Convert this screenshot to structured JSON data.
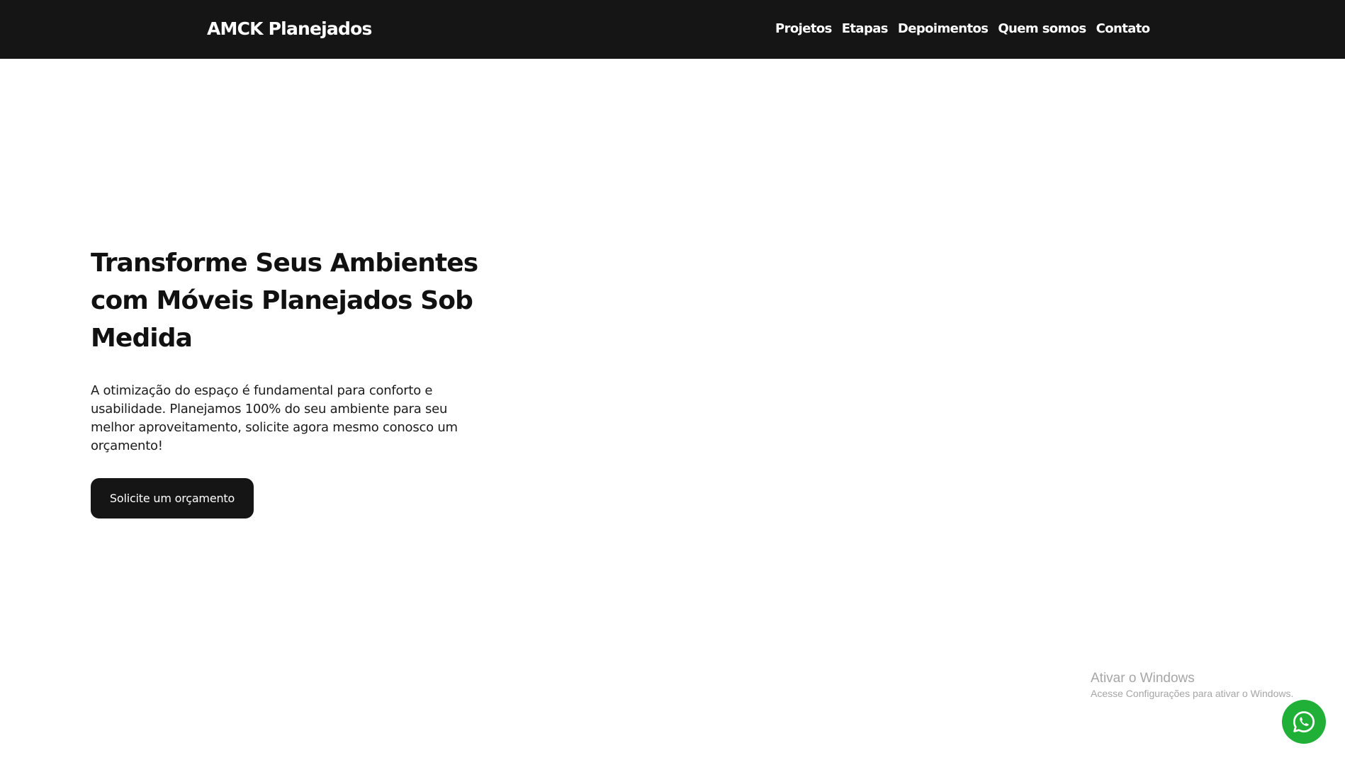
{
  "header": {
    "brand": "AMCK Planejados",
    "nav": [
      {
        "label": "Projetos"
      },
      {
        "label": "Etapas"
      },
      {
        "label": "Depoimentos"
      },
      {
        "label": "Quem somos"
      },
      {
        "label": "Contato"
      }
    ]
  },
  "hero": {
    "title": "Transforme Seus Ambientes com Móveis Planejados Sob Medida",
    "description": "A otimização do espaço é fundamental para conforto e usabilidade. Planejamos 100% do seu ambiente para seu melhor aproveitamento, solicite agora mesmo conosco um orçamento!",
    "button_label": "Solicite um orçamento"
  },
  "windows_watermark": {
    "title": "Ativar o Windows",
    "subtitle": "Acesse Configurações para ativar o Windows."
  },
  "floating_button": {
    "icon": "whatsapp-icon",
    "color": "#20b038"
  },
  "colors": {
    "header_bg": "#151515",
    "button_bg": "#151515",
    "text": "#111111",
    "watermark": "#a6a6a6"
  }
}
